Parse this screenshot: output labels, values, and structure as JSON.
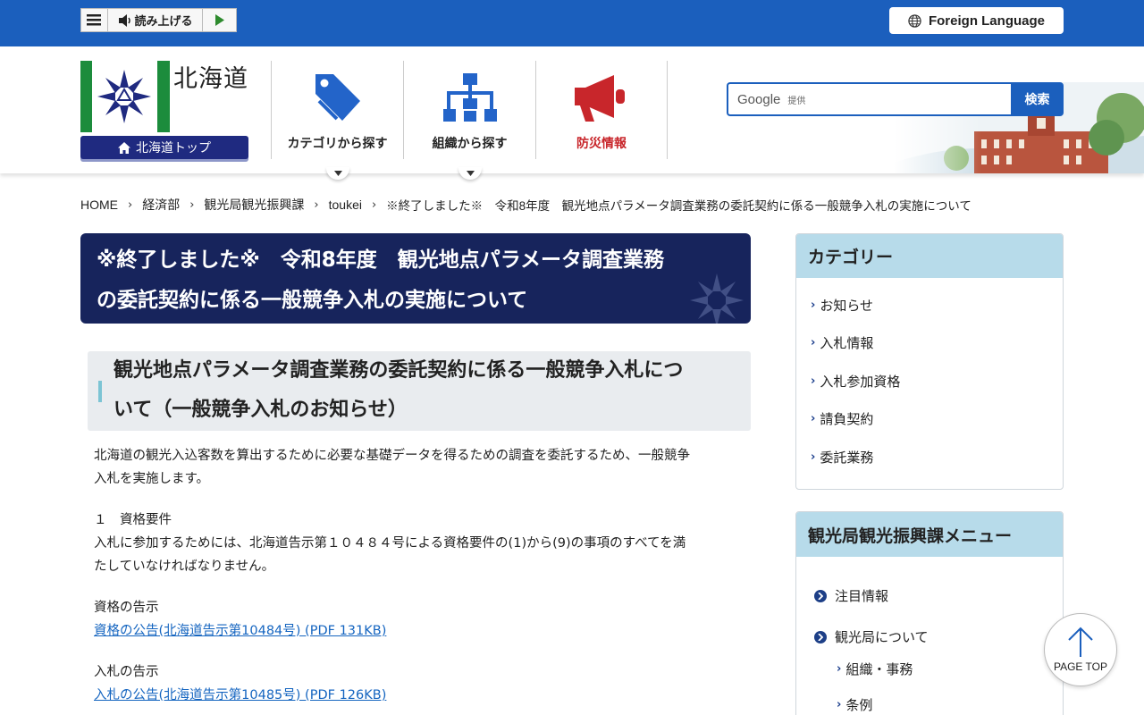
{
  "topbar": {
    "read_aloud_label": "読み上げる",
    "foreign_language_label": "Foreign Language"
  },
  "header": {
    "logo_text": "北海道",
    "hokkaido_top_label": "北海道トップ",
    "nav": [
      {
        "label": "カテゴリから探す"
      },
      {
        "label": "組織から探す"
      },
      {
        "label": "防災情報"
      }
    ],
    "search": {
      "google_label": "Google",
      "provided_label": "提供",
      "button_label": "検索"
    }
  },
  "breadcrumb": [
    "HOME",
    "経済部",
    "観光局観光振興課",
    "toukei",
    "※終了しました※　令和8年度　観光地点パラメータ調査業務の委託契約に係る一般競争入札の実施について"
  ],
  "page_title": {
    "line1": "※終了しました※　令和8年度　観光地点パラメータ調査業務",
    "line2": "の委託契約に係る一般競争入札の実施について"
  },
  "section": {
    "heading_line1": "観光地点パラメータ調査業務の委託契約に係る一般競争入札につ",
    "heading_line2": "いて（一般競争入札のお知らせ）",
    "intro_line1": "北海道の観光入込客数を算出するために必要な基礎データを得るための調査を委託するため、一般競争",
    "intro_line2": "入札を実施します。",
    "req_heading": "１　資格要件",
    "req_line1": "入札に参加するためには、北海道告示第１０４８４号による資格要件の(1)から(9)の事項のすべてを満",
    "req_line2": "たしていなければなりません。",
    "qual_notice_label": "資格の告示",
    "qual_notice_link": "資格の公告(北海道告示第10484号) (PDF 131KB)",
    "bid_notice_label": "入札の告示",
    "bid_notice_link": "入札の公告(北海道告示第10485号) (PDF 126KB)"
  },
  "sidebar": {
    "category_title": "カテゴリー",
    "category_items": [
      "お知らせ",
      "入札情報",
      "入札参加資格",
      "請負契約",
      "委託業務"
    ],
    "menu_title": "観光局観光振興課メニュー",
    "menu_items": [
      {
        "label": "注目情報"
      },
      {
        "label": "観光局について"
      }
    ],
    "menu_subitems": [
      "組織・事務",
      "条例"
    ]
  },
  "page_top_label": "PAGE TOP",
  "colors": {
    "brand_blue": "#1b5fbd",
    "title_navy": "#17245c",
    "emblem_green": "#1c8c3c",
    "disaster_red": "#c8262b"
  }
}
